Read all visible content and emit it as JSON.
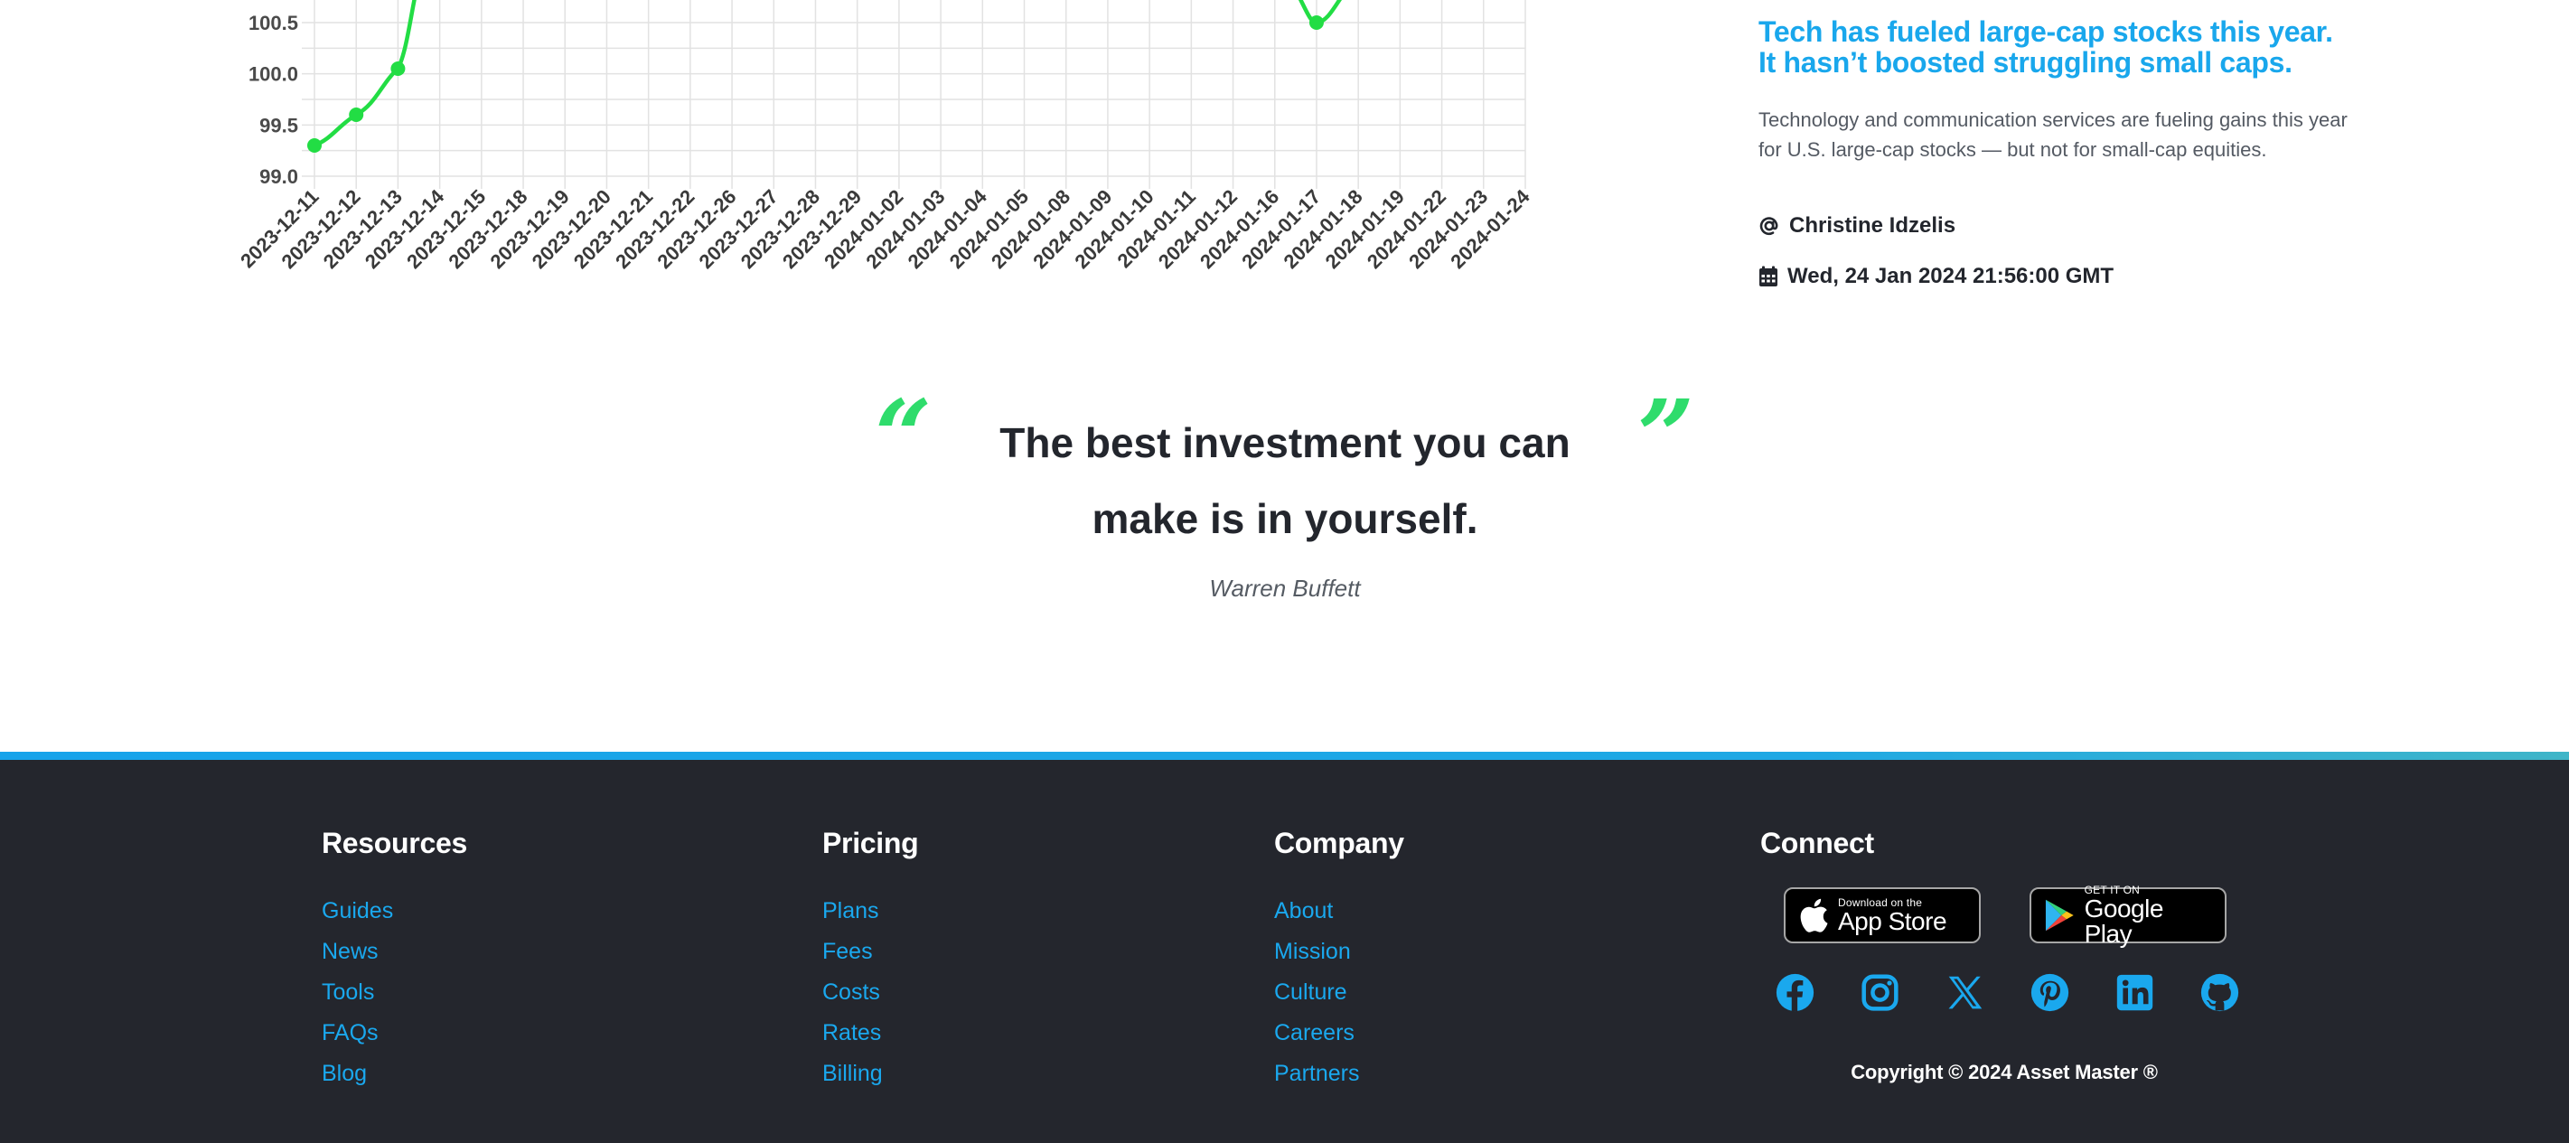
{
  "chart_data": {
    "type": "line",
    "x": [
      "2023-12-11",
      "2023-12-12",
      "2023-12-13",
      "2023-12-14",
      "2023-12-15",
      "2023-12-18",
      "2023-12-19",
      "2023-12-20",
      "2023-12-21",
      "2023-12-22",
      "2023-12-26",
      "2023-12-27",
      "2023-12-28",
      "2023-12-29",
      "2024-01-02",
      "2024-01-03",
      "2024-01-04",
      "2024-01-05",
      "2024-01-08",
      "2024-01-09",
      "2024-01-10",
      "2024-01-11",
      "2024-01-12",
      "2024-01-16",
      "2024-01-17",
      "2024-01-18",
      "2024-01-19",
      "2024-01-22",
      "2024-01-23",
      "2024-01-24"
    ],
    "visible_points": [
      {
        "x": "2023-12-11",
        "y": 99.3
      },
      {
        "x": "2023-12-12",
        "y": 99.6
      },
      {
        "x": "2023-12-13",
        "y": 100.05
      },
      {
        "x": "2024-01-17",
        "y": 100.5
      }
    ],
    "y_ticks": [
      "100.5",
      "100.0",
      "99.5",
      "99.0"
    ],
    "ylim": [
      99.0,
      100.5
    ],
    "grid": true,
    "line_color": "#22dd44"
  },
  "article": {
    "title": "Tech has fueled large-cap stocks this year. It hasn’t boosted struggling small caps.",
    "summary": "Technology and communication services are fueling gains this year for U.S. large-cap stocks — but not for small-cap equities.",
    "author": "Christine Idzelis",
    "date": "Wed, 24 Jan 2024 21:56:00 GMT"
  },
  "quote": {
    "open_mark": "“",
    "close_mark": "”",
    "text": "The best investment you can make is in yourself.",
    "author": "Warren Buffett"
  },
  "footer": {
    "resources": {
      "heading": "Resources",
      "links": [
        "Guides",
        "News",
        "Tools",
        "FAQs",
        "Blog"
      ]
    },
    "pricing": {
      "heading": "Pricing",
      "links": [
        "Plans",
        "Fees",
        "Costs",
        "Rates",
        "Billing"
      ]
    },
    "company": {
      "heading": "Company",
      "links": [
        "About",
        "Mission",
        "Culture",
        "Careers",
        "Partners"
      ]
    },
    "connect": {
      "heading": "Connect",
      "app_store": {
        "small": "Download on the",
        "big": "App Store"
      },
      "google_play": {
        "small": "GET IT ON",
        "big": "Google Play"
      },
      "social_icons": [
        "facebook-icon",
        "instagram-icon",
        "x-icon",
        "pinterest-icon",
        "linkedin-icon",
        "github-icon"
      ]
    },
    "copyright": "Copyright © 2024 Asset Master ®"
  },
  "colors": {
    "accent": "#19a7ec",
    "quote_mark": "#2fdc6c",
    "footer_bg": "#24262d"
  }
}
